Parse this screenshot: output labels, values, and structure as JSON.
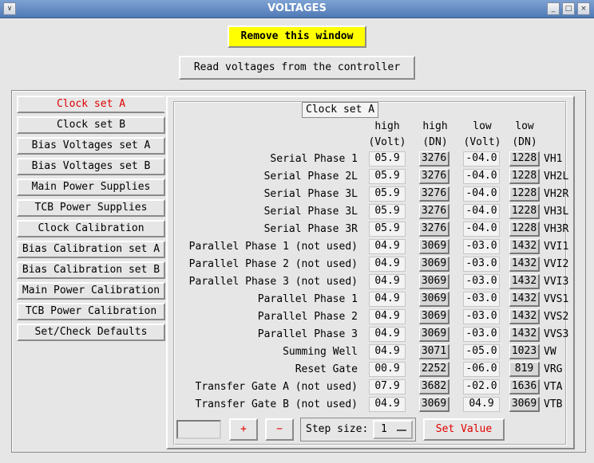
{
  "window": {
    "title": "VOLTAGES",
    "controls": [
      "∨",
      "_",
      "□",
      "×"
    ]
  },
  "top_buttons": {
    "remove": "Remove this window",
    "read": "Read voltages from the controller"
  },
  "sidebar": {
    "items": [
      {
        "label": "Clock set A",
        "active": true
      },
      {
        "label": "Clock set B"
      },
      {
        "label": "Bias Voltages set A"
      },
      {
        "label": "Bias Voltages set B"
      },
      {
        "label": "Main Power Supplies"
      },
      {
        "label": "TCB Power Supplies"
      },
      {
        "label": "Clock Calibration"
      },
      {
        "label": "Bias Calibration set A"
      },
      {
        "label": "Bias Calibration set B"
      },
      {
        "label": "Main Power Calibration"
      },
      {
        "label": "TCB Power Calibration"
      },
      {
        "label": "Set/Check Defaults"
      }
    ]
  },
  "panel": {
    "tab_title": "Clock set A",
    "headers": [
      {
        "top": "high",
        "bottom": "(Volt)"
      },
      {
        "top": "high",
        "bottom": "(DN)"
      },
      {
        "top": "low",
        "bottom": "(Volt)"
      },
      {
        "top": "low",
        "bottom": "(DN)"
      }
    ],
    "rows": [
      {
        "label": "Serial Phase 1",
        "high_volt": "05.9",
        "high_dn": "3276",
        "low_volt": "-04.0",
        "low_dn": "1228",
        "code": "VH1"
      },
      {
        "label": "Serial Phase 2L",
        "high_volt": "05.9",
        "high_dn": "3276",
        "low_volt": "-04.0",
        "low_dn": "1228",
        "code": "VH2L"
      },
      {
        "label": "Serial Phase 3L",
        "high_volt": "05.9",
        "high_dn": "3276",
        "low_volt": "-04.0",
        "low_dn": "1228",
        "code": "VH2R"
      },
      {
        "label": "Serial Phase 3L",
        "high_volt": "05.9",
        "high_dn": "3276",
        "low_volt": "-04.0",
        "low_dn": "1228",
        "code": "VH3L"
      },
      {
        "label": "Serial Phase 3R",
        "high_volt": "05.9",
        "high_dn": "3276",
        "low_volt": "-04.0",
        "low_dn": "1228",
        "code": "VH3R"
      },
      {
        "label": "Parallel Phase 1 (not used)",
        "high_volt": "04.9",
        "high_dn": "3069",
        "low_volt": "-03.0",
        "low_dn": "1432",
        "code": "VVI1"
      },
      {
        "label": "Parallel Phase 2 (not used)",
        "high_volt": "04.9",
        "high_dn": "3069",
        "low_volt": "-03.0",
        "low_dn": "1432",
        "code": "VVI2"
      },
      {
        "label": "Parallel Phase 3 (not used)",
        "high_volt": "04.9",
        "high_dn": "3069",
        "low_volt": "-03.0",
        "low_dn": "1432",
        "code": "VVI3"
      },
      {
        "label": "Parallel Phase 1",
        "high_volt": "04.9",
        "high_dn": "3069",
        "low_volt": "-03.0",
        "low_dn": "1432",
        "code": "VVS1"
      },
      {
        "label": "Parallel Phase 2",
        "high_volt": "04.9",
        "high_dn": "3069",
        "low_volt": "-03.0",
        "low_dn": "1432",
        "code": "VVS2"
      },
      {
        "label": "Parallel Phase 3",
        "high_volt": "04.9",
        "high_dn": "3069",
        "low_volt": "-03.0",
        "low_dn": "1432",
        "code": "VVS3"
      },
      {
        "label": "Summing Well",
        "high_volt": "04.9",
        "high_dn": "3071",
        "low_volt": "-05.0",
        "low_dn": "1023",
        "code": "VW"
      },
      {
        "label": "Reset Gate",
        "high_volt": "00.9",
        "high_dn": "2252",
        "low_volt": "-06.0",
        "low_dn": "819",
        "code": "VRG"
      },
      {
        "label": "Transfer Gate A (not used)",
        "high_volt": "07.9",
        "high_dn": "3682",
        "low_volt": "-02.0",
        "low_dn": "1636",
        "code": "VTA"
      },
      {
        "label": "Transfer Gate B (not used)",
        "high_volt": "04.9",
        "high_dn": "3069",
        "low_volt": "04.9",
        "low_dn": "3069",
        "code": "VTB"
      }
    ]
  },
  "controls": {
    "step_input_value": "",
    "plus": "+",
    "minus": "−",
    "step_label": "Step size:",
    "step_value": "1",
    "set_value": "Set Value"
  }
}
